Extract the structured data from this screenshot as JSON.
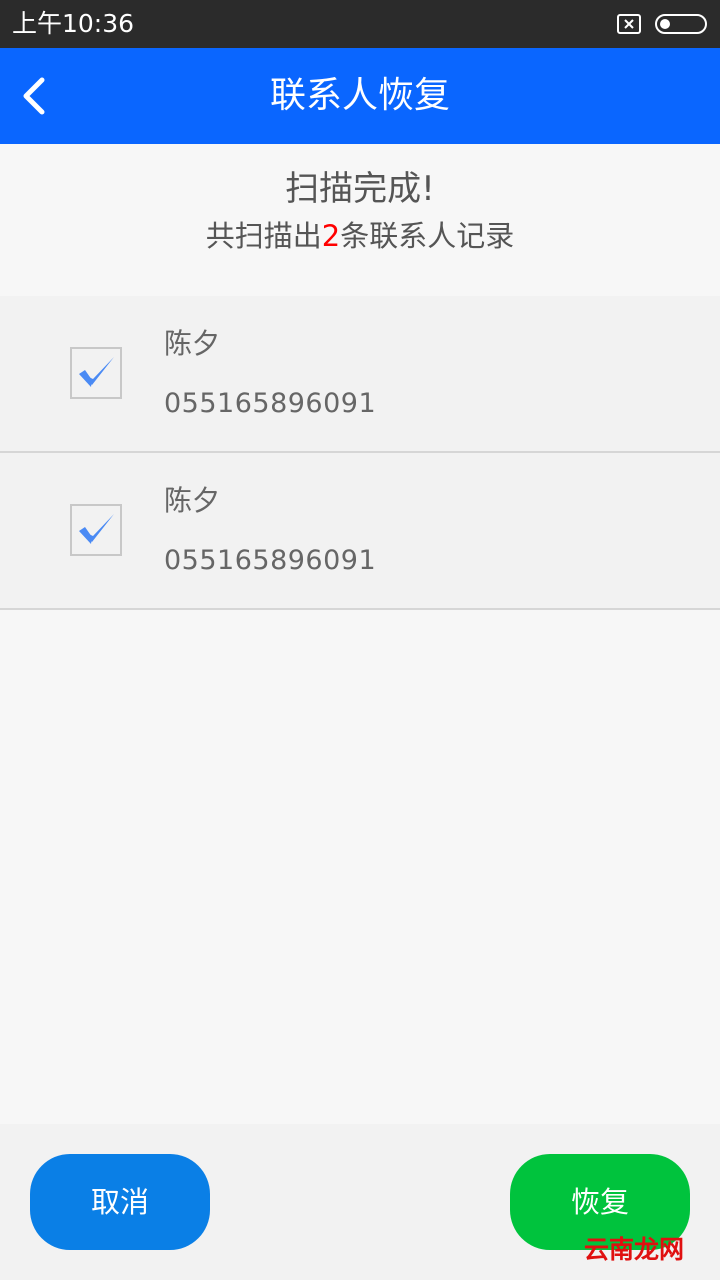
{
  "status_bar": {
    "time": "上午10:36"
  },
  "header": {
    "title": "联系人恢复",
    "back_icon": "chevron-left-icon"
  },
  "summary": {
    "title": "扫描完成!",
    "sub_prefix": "共扫描出",
    "count": "2",
    "sub_suffix": "条联系人记录"
  },
  "contacts": [
    {
      "name": "陈夕",
      "phone": "055165896091",
      "checked": true
    },
    {
      "name": "陈夕",
      "phone": "055165896091",
      "checked": true
    }
  ],
  "buttons": {
    "cancel_label": "取消",
    "restore_label": "恢复"
  },
  "watermark": {
    "text": "云南龙网"
  },
  "colors": {
    "nav_bar": "#0a66ff",
    "cancel_button": "#0a7fe6",
    "restore_button": "#00c33d",
    "count_highlight": "#ff0000",
    "checkmark": "#4a8af4"
  }
}
